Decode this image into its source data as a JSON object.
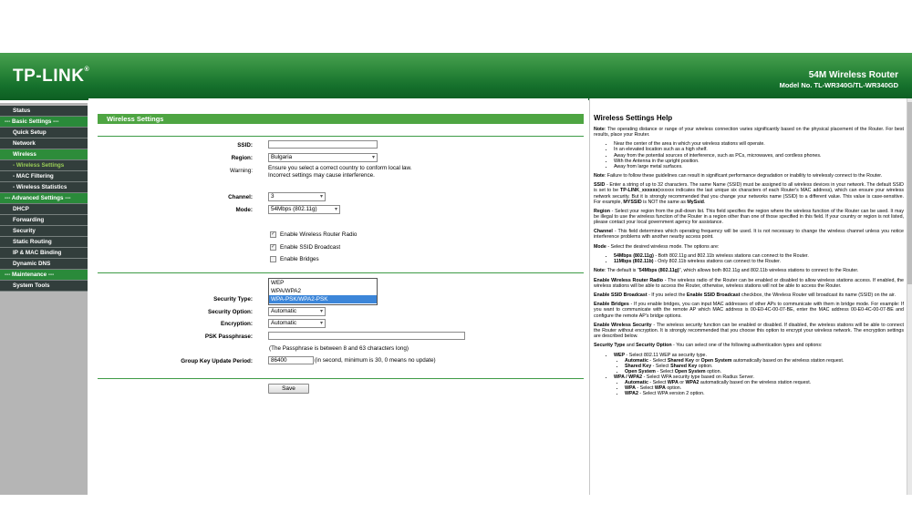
{
  "header": {
    "logo": "TP-LINK",
    "logo_mark": "®",
    "title": "54M Wireless Router",
    "model": "Model No. TL-WR340G/TL-WR340GD"
  },
  "sidebar": {
    "items": [
      {
        "label": "Status",
        "type": "item"
      },
      {
        "label": "--- Basic Settings ---",
        "type": "section"
      },
      {
        "label": "Quick Setup",
        "type": "item"
      },
      {
        "label": "Network",
        "type": "item"
      },
      {
        "label": "Wireless",
        "type": "active"
      },
      {
        "label": "- Wireless Settings",
        "type": "subcur"
      },
      {
        "label": "- MAC Filtering",
        "type": "sub"
      },
      {
        "label": "- Wireless Statistics",
        "type": "sub"
      },
      {
        "label": "--- Advanced Settings ---",
        "type": "section"
      },
      {
        "label": "DHCP",
        "type": "item"
      },
      {
        "label": "Forwarding",
        "type": "item"
      },
      {
        "label": "Security",
        "type": "item"
      },
      {
        "label": "Static Routing",
        "type": "item"
      },
      {
        "label": "IP & MAC Binding",
        "type": "item"
      },
      {
        "label": "Dynamic DNS",
        "type": "item"
      },
      {
        "label": "--- Maintenance ---",
        "type": "section"
      },
      {
        "label": "System Tools",
        "type": "item"
      }
    ]
  },
  "form": {
    "title": "Wireless Settings",
    "ssid_label": "SSID:",
    "ssid_value": "",
    "region_label": "Region:",
    "region_value": "Bulgaria",
    "warning_label": "Warning:",
    "warning_text": "Ensure you select a correct country to conform local law. Incorrect settings may cause interference.",
    "channel_label": "Channel:",
    "channel_value": "3",
    "mode_label": "Mode:",
    "mode_value": "54Mbps (802.11g)",
    "enable_radio": "Enable Wireless Router Radio",
    "enable_ssid": "Enable SSID Broadcast",
    "enable_bridges": "Enable Bridges",
    "security_type_label": "Security Type:",
    "security_type_options": [
      "WEP",
      "WPA/WPA2",
      "WPA-PSK/WPA2-PSK"
    ],
    "security_option_label": "Security Option:",
    "security_option_value": "Automatic",
    "encryption_label": "Encryption:",
    "encryption_value": "Automatic",
    "psk_label": "PSK Passphrase:",
    "psk_value": "",
    "psk_note": "(The Passphrase is between 8 and 63 characters long)",
    "group_key_label": "Group Key Update Period:",
    "group_key_value": "86400",
    "group_key_note": "(in second, minimum is 30, 0 means no update)",
    "save_label": "Save"
  },
  "help": {
    "title": "Wireless Settings Help",
    "note1_b": "Note",
    "note1": ": The operating distance or range of your wireless connection varies significantly based on the physical placement of the Router. For best results, place your Router.",
    "list1": [
      "Near the center of the area in which your wireless stations will operate.",
      "In an elevated location such as a high shelf.",
      "Away from the potential sources of interference, such as PCs, microwaves, and cordless phones.",
      "With the Antenna in the upright position.",
      "Away from large metal surfaces."
    ],
    "note2_b": "Note",
    "note2": ": Failure to follow these guidelines can result in significant performance degradation or inability to wirelessly connect to the Router.",
    "ssid_b": "SSID",
    "ssid_1": " - Enter a string of up to 32 characters. The same Name (SSID) must be assigned to all wireless devices in your network. The default SSID is set to be ",
    "ssid_2": "TP-LINK_xxxxxx",
    "ssid_3": "(xxxxxx indicates the last unique six characters of each Router's MAC address), which can ensure your wireless network security. But it is strongly recommended that you change your networks name (SSID) to a different value. This value is case-sensitive. For example, ",
    "ssid_4": "MYSSID",
    "ssid_5": " is NOT the same as ",
    "ssid_6": "MySsid",
    "ssid_7": ".",
    "region_b": "Region",
    "region": " - Select your region from the pull-down list. This field specifies the region where the wireless function of the Router can be used. It may be illegal to use the wireless function of the Router in a region other than one of those specified in this field. If your country or region is not listed, please contact your local government agency for assistance.",
    "channel_b": "Channel",
    "channel": " - This field determines which operating frequency will be used. It is not necessary to change the wireless channel unless you notice interference problems with another nearby access point.",
    "mode_b": "Mode",
    "mode": " - Select the desired wireless mode. The options are:",
    "mode_list": [
      {
        "b": "54Mbps (802.11g)",
        "t": " - Both 802.11g and 802.11b wireless stations can connect to the Router."
      },
      {
        "b": "11Mbps (802.11b)",
        "t": " - Only 802.11b wireless stations can connect to the Router."
      }
    ],
    "note3_b": "Note",
    "note3_1": ": The default is \"",
    "note3_2": "54Mbps (802.11g)",
    "note3_3": "\", which allows both 802.11g and 802.11b wireless stations to connect to the Router.",
    "radio_b": "Enable Wireless Router Radio",
    "radio": " - The wireless radio of the Router can be enabled or disabled to allow wireless stations access. If enabled, the wireless stations will be able to access the Router, otherwise, wireless stations will not be able to access the Router.",
    "ssidb_b": "Enable SSID Broadcast",
    "ssidb_1": " - If you select the ",
    "ssidb_2": "Enable SSID Broadcast",
    "ssidb_3": " checkbox, the Wireless Router will broadcast its name (SSID) on the air.",
    "bridge_b": "Enable Bridges",
    "bridge": " - If you enable bridges, you can input MAC addresses of other APs to communicate with them in bridge mode. For example: If you want to communicate with the remote AP which MAC address is 00-E0-4C-00-07-BE, enter the MAC address 00-E0-4C-00-07-BE and configure the remote AP's bridge options.",
    "wsec_b": "Enable Wireless Security",
    "wsec": " - The wireless security function can be enabled or disabled. If disabled, the wireless stations will be able to connect the Router without encryption. It is strongly recommended that you choose this option to encrypt your wireless network. The encryption settings are described below.",
    "stype_b1": "Security Type",
    "stype_and": " and ",
    "stype_b2": "Security Option",
    "stype": " - You can select one of the following authentication types and options:",
    "wep_b": "WEP",
    "wep": " - Select 802.11 WEP as security type.",
    "wep_auto_b": "Automatic",
    "wep_auto_1": " - Select ",
    "wep_auto_2": "Shared Key",
    "wep_auto_3": " or ",
    "wep_auto_4": "Open System",
    "wep_auto_5": " automatically based on the wireless station request.",
    "wep_sk_b": "Shared Key",
    "wep_sk_1": " - Select ",
    "wep_sk_2": "Shared Key",
    "wep_sk_3": " option.",
    "wep_os_b": "Open System",
    "wep_os_1": " - Select ",
    "wep_os_2": "Open System",
    "wep_os_3": " option.",
    "wpa_b": "WPA / WPA2",
    "wpa": " - Select WPA security type based on Radius Server.",
    "wpa_auto_b": "Automatic",
    "wpa_auto_1": " - Select ",
    "wpa_auto_2": "WPA",
    "wpa_auto_3": " or ",
    "wpa_auto_4": "WPA2",
    "wpa_auto_5": " automatically based on the wireless station request.",
    "wpa_wpa_b": "WPA",
    "wpa_wpa_1": " - Select ",
    "wpa_wpa_2": "WPA",
    "wpa_wpa_3": " option.",
    "wpa_wpa2_b": "WPA2",
    "wpa_wpa2": " - Select WPA version 2 option."
  }
}
